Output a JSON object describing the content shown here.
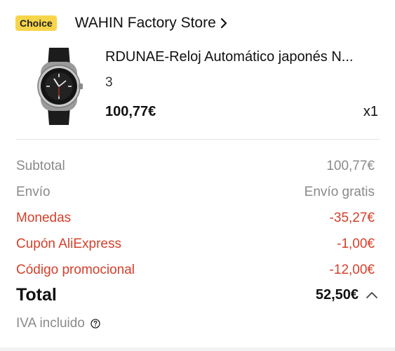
{
  "store": {
    "badge": "Choice",
    "name": "WAHIN Factory Store"
  },
  "product": {
    "title": "RDUNAE-Reloj Automático japonés N...",
    "variant": "3",
    "price": "100,77€",
    "quantity": "x1"
  },
  "summary": {
    "rows": [
      {
        "label": "Subtotal",
        "value": "100,77€"
      },
      {
        "label": "Envío",
        "value": "Envío gratis"
      },
      {
        "label": "Monedas",
        "value": "-35,27€"
      },
      {
        "label": "Cupón AliExpress",
        "value": "-1,00€"
      },
      {
        "label": "Código promocional",
        "value": "-12,00€"
      }
    ],
    "total_label": "Total",
    "total_value": "52,50€",
    "tax_note": "IVA incluido"
  },
  "colors": {
    "badge_bg": "#f7d54a",
    "discount_red": "#d4402b",
    "muted_gray": "#8a8a8a"
  },
  "icons": {
    "store_chevron": "chevron-right-icon",
    "total_toggle": "chevron-up-icon",
    "help": "question-circle-icon"
  }
}
